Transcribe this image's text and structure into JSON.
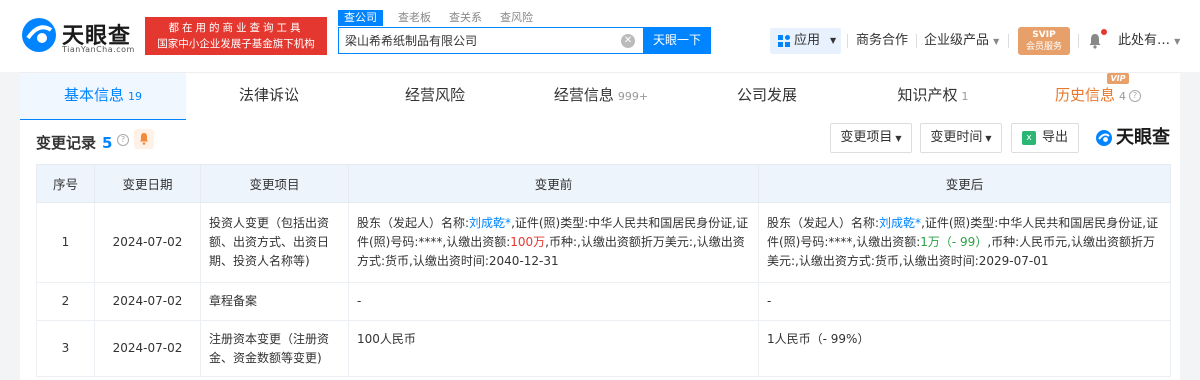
{
  "header": {
    "logo_cn": "天眼查",
    "logo_en": "TianYanCha.com",
    "slogan_line1": "都在用的商业查询工具",
    "slogan_line2": "国家中小企业发展子基金旗下机构",
    "search_tabs": [
      "查公司",
      "查老板",
      "查关系",
      "查风险"
    ],
    "search_value": "梁山希希纸制品有限公司",
    "search_button": "天眼一下",
    "app_label": "应用",
    "nav_links": [
      "商务合作",
      "企业级产品"
    ],
    "vip_line1": "SVIP",
    "vip_line2": "会员服务",
    "user_name": "此处有…"
  },
  "tabs": [
    {
      "label": "基本信息",
      "count": "19"
    },
    {
      "label": "法律诉讼",
      "count": ""
    },
    {
      "label": "经营风险",
      "count": ""
    },
    {
      "label": "经营信息",
      "count": "999+"
    },
    {
      "label": "公司发展",
      "count": ""
    },
    {
      "label": "知识产权",
      "count": "1"
    },
    {
      "label": "历史信息",
      "count": "4"
    }
  ],
  "history_vip_tag": "VIP",
  "section": {
    "title": "变更记录",
    "count": "5",
    "filter_item": "变更项目",
    "filter_time": "变更时间",
    "export": "导出",
    "watermark": "天眼查"
  },
  "table": {
    "headers": [
      "序号",
      "变更日期",
      "变更项目",
      "变更前",
      "变更后"
    ],
    "rows": [
      {
        "no": "1",
        "date": "2024-07-02",
        "item": "投资人变更（包括出资额、出资方式、出资日期、投资人名称等)",
        "before": {
          "p1": "股东（发起人）名称:",
          "name": "刘成乾*",
          "p2": ",证件(照)类型:中华人民共和国居民身份证,证件(照)号码:****,认缴出资额:",
          "amount": "100万",
          "p3": ",币种:,认缴出资额折万美元:,认缴出资方式:货币,认缴出资时间:2040-12-31"
        },
        "after": {
          "p1": "股东（发起人）名称:",
          "name": "刘成乾*",
          "p2": ",证件(照)类型:中华人民共和国居民身份证,证件(照)号码:****,认缴出资额:",
          "amount": "1万（- 99）",
          "p3": ",币种:人民币元,认缴出资额折万美元:,认缴出资方式:货币,认缴出资时间:2029-07-01"
        }
      },
      {
        "no": "2",
        "date": "2024-07-02",
        "item": "章程备案",
        "before_text": "-",
        "after_text": "-"
      },
      {
        "no": "3",
        "date": "2024-07-02",
        "item": "注册资本变更（注册资金、资金数额等变更)",
        "before_text": "100人民币",
        "after_text": "1人民币（- 99%）"
      }
    ]
  },
  "colors": {
    "brand_blue": "#0084ff",
    "slogan_red": "#e4372f",
    "history_orange": "#e8782b",
    "decrease_green": "#2ba245"
  }
}
